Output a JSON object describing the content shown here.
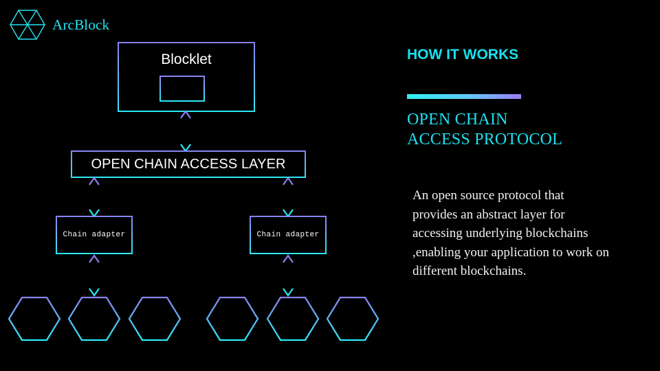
{
  "brand": {
    "name": "ArcBlock",
    "logo_icon": "hexagon-triforce-icon"
  },
  "colors": {
    "background": "#000000",
    "accent_cyan": "#2ae9f7",
    "accent_purple": "#8a82f2",
    "text_white": "#ffffff",
    "brand_cyan": "#26e4ef"
  },
  "diagram": {
    "blocklet": {
      "label": "Blocklet",
      "inner_label": ""
    },
    "access_layer": {
      "label": "OPEN CHAIN ACCESS LAYER"
    },
    "adapters": [
      {
        "label": "Chain adapter"
      },
      {
        "label": "Chain adapter"
      }
    ],
    "chains": [
      {
        "label": ""
      },
      {
        "label": ""
      },
      {
        "label": ""
      },
      {
        "label": ""
      },
      {
        "label": ""
      },
      {
        "label": ""
      }
    ],
    "connectors": [
      {
        "name": "blocklet-to-access-layer",
        "type": "double-arrow-vertical"
      },
      {
        "name": "access-layer-to-adapter-1",
        "type": "double-arrow-vertical"
      },
      {
        "name": "access-layer-to-adapter-2",
        "type": "double-arrow-vertical"
      },
      {
        "name": "adapter-1-to-chain",
        "type": "double-arrow-vertical"
      },
      {
        "name": "adapter-2-to-chain",
        "type": "double-arrow-vertical"
      }
    ]
  },
  "panel": {
    "kicker": "HOW IT WORKS",
    "title": "OPEN CHAIN ACCESS PROTOCOL",
    "body": "An open source protocol that provides an abstract layer for accessing underlying blockchains ,enabling your application to work on different blockchains."
  }
}
